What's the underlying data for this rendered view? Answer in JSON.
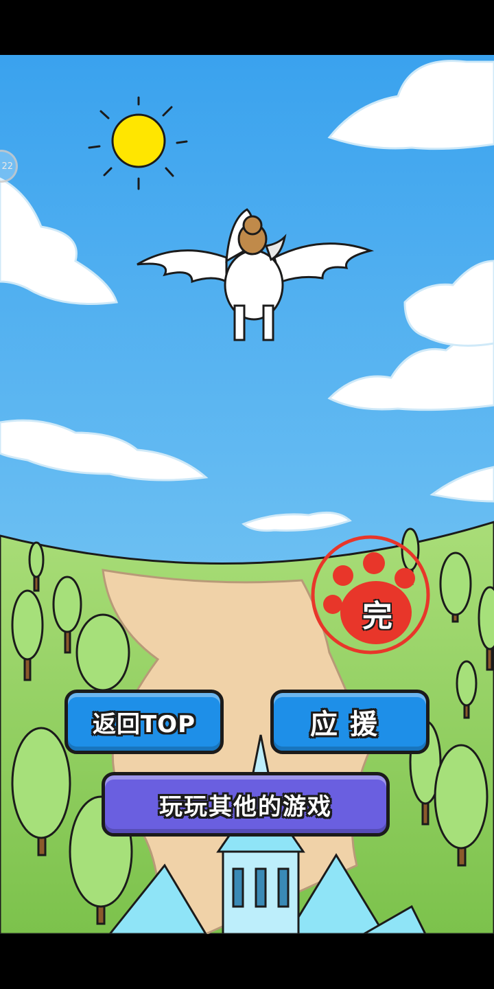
{
  "scene": {
    "sky_color": "#4aaef0",
    "grass_color": "#8fcf5c",
    "path_color": "#f0d2a8",
    "sun_color": "#ffe600"
  },
  "stamp": {
    "char": "完",
    "color": "#e8362a",
    "icon": "paw-stamp-icon"
  },
  "side_bubble": {
    "label": "22"
  },
  "buttons": {
    "top_label": "返回TOP",
    "support_label": "应援",
    "games_label": "玩玩其他的游戏"
  }
}
